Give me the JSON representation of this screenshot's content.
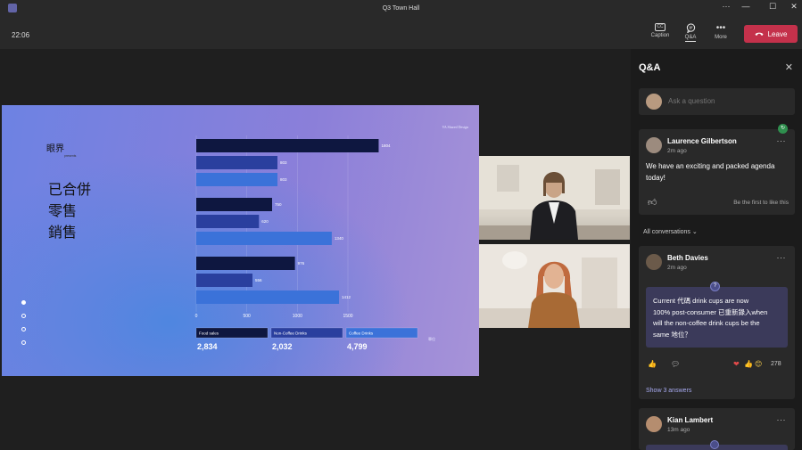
{
  "window": {
    "title": "Q3 Town Hall",
    "controls": [
      "···",
      "—",
      "☐",
      "✕"
    ]
  },
  "toolbar": {
    "timer": "22:06",
    "caption_label": "Caption",
    "caption_icon_text": "CC",
    "qa_label": "Q&A",
    "more_label": "More",
    "leave_label": "Leave"
  },
  "slide": {
    "logo_text": "眼界",
    "logo_sub": "presents",
    "brand": "VA Shared Design",
    "heading_lines": [
      "已合併",
      "零售",
      "銷售"
    ],
    "nav_dots": 4,
    "unit_label": "單位"
  },
  "chart_data": {
    "type": "bar",
    "orientation": "horizontal",
    "x_ticks": [
      0,
      500,
      1000,
      1500
    ],
    "xlim": [
      0,
      1500
    ],
    "series": [
      {
        "name": "Food sales",
        "color": "#0e1740"
      },
      {
        "name": "Non-Coffee Drinks",
        "color": "#2a3f9e"
      },
      {
        "name": "Coffee Drinks",
        "color": "#3b72d9"
      }
    ],
    "groups": [
      {
        "values": [
          1804,
          803,
          803
        ]
      },
      {
        "values": [
          750,
          620,
          1340
        ]
      },
      {
        "values": [
          976,
          556,
          1412
        ]
      }
    ],
    "totals": [
      "2,834",
      "2,032",
      "4,799"
    ]
  },
  "qa_panel": {
    "title": "Q&A",
    "ask_placeholder": "Ask a question",
    "all_conversations": "All conversations",
    "posts": [
      {
        "name": "Laurence Gilbertson",
        "time": "2m ago",
        "text_lines": [
          "We have an exciting and packed agenda",
          "today!"
        ],
        "first_like": "Be the first to like this"
      },
      {
        "name": "Beth Davies",
        "time": "2m ago",
        "question_lines": [
          "Current 代碼   drink cups are now",
          "100% post-consumer 已重新錄入when",
          "will the non-coffee drink cups be the",
          "same 地位？"
        ],
        "reaction_count": "278",
        "show_answers": "Show 3 answers"
      },
      {
        "name": "Kian Lambert",
        "time": "13m ago"
      }
    ]
  }
}
